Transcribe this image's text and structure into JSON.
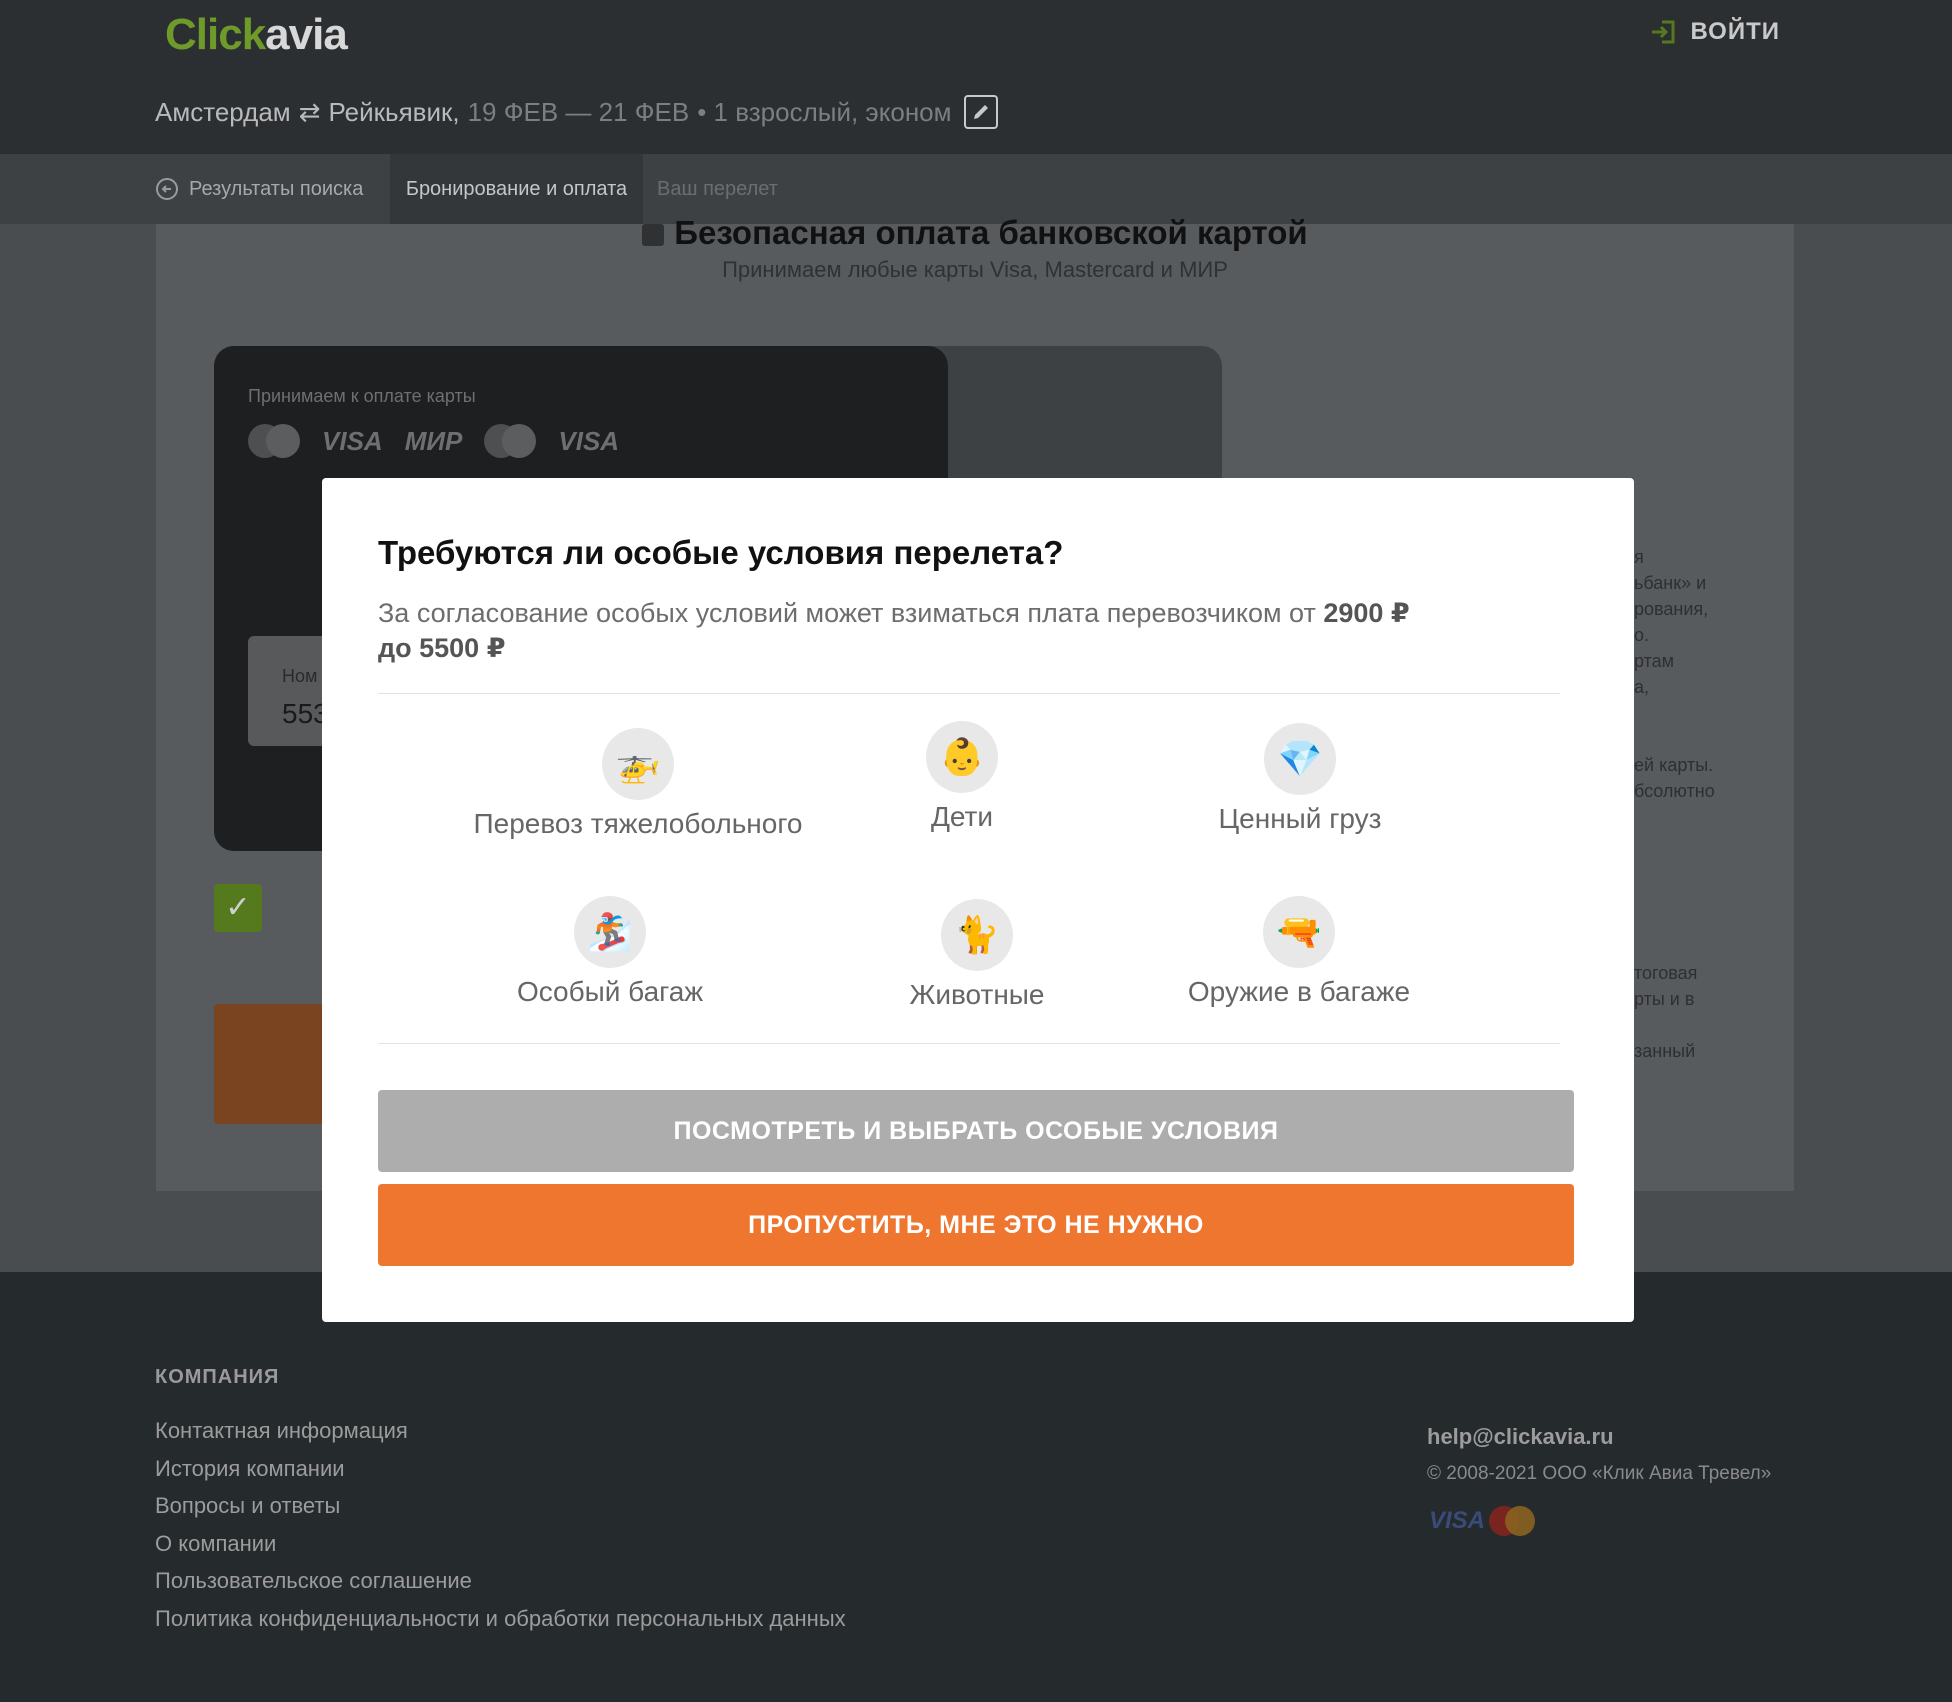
{
  "header": {
    "logo_part1": "Click",
    "logo_part2": "avia",
    "login_label": "ВОЙТИ"
  },
  "search": {
    "from": "Амстердам",
    "swap_symbol": "⇄",
    "to": "Рейкьявик,",
    "dates": "19 ФЕВ — 21 ФЕВ",
    "passengers": "• 1 взрослый, эконом"
  },
  "breadcrumbs": {
    "back": "Результаты поиска",
    "active": "Бронирование и оплата",
    "next": "Ваш перелет"
  },
  "payment": {
    "title": "Безопасная оплата банковской картой",
    "subtitle": "Принимаем любые карты Visa, Mastercard и МИР",
    "accept_label": "Принимаем к оплате карты",
    "card_logos": [
      "VISA",
      "МИР",
      "VISA"
    ],
    "card_number_label": "Ном",
    "card_number_value": "553"
  },
  "side_text": [
    "я",
    "ьбанк» и",
    "рования,",
    "о.",
    "",
    "ртам",
    "а,",
    "",
    "",
    "ей карты.",
    "бсолютно",
    "",
    "",
    "",
    "",
    "",
    "",
    "тоговая",
    "рты и в",
    "",
    "занный"
  ],
  "modal": {
    "title": "Требуются ли особые условия перелета?",
    "desc_prefix": "За согласование особых условий может взиматься плата перевозчиком от ",
    "desc_from": "2900 ₽",
    "desc_mid": " ",
    "desc_to": "до 5500 ₽",
    "options": [
      {
        "label": "Перевоз тяжелобольного",
        "emoji": "🚁",
        "icon": "helicopter-icon"
      },
      {
        "label": "Дети",
        "emoji": "👶",
        "icon": "baby-icon"
      },
      {
        "label": "Ценный груз",
        "emoji": "💎",
        "icon": "gem-icon"
      },
      {
        "label": "Особый багаж",
        "emoji": "🏂",
        "icon": "snowboarder-icon"
      },
      {
        "label": "Животные",
        "emoji": "🐈",
        "icon": "cat-icon"
      },
      {
        "label": "Оружие в багаже",
        "emoji": "🔫",
        "icon": "water-pistol-icon"
      }
    ],
    "view_button": "ПОСМОТРЕТЬ И ВЫБРАТЬ ОСОБЫЕ УСЛОВИЯ",
    "skip_button": "ПРОПУСТИТЬ, МНЕ ЭТО НЕ НУЖНО"
  },
  "footer": {
    "heading": "КОМПАНИЯ",
    "links": [
      "Контактная информация",
      "История компании",
      "Вопросы и ответы",
      "О компании",
      "Пользовательское соглашение",
      "Политика конфиденциальности и обработки персональных данных"
    ],
    "email": "help@clickavia.ru",
    "copyright": "© 2008-2021 ООО «Клик Авиа Тревел»",
    "visa": "VISA"
  },
  "colors": {
    "accent_orange": "#ef762f",
    "brand_green": "#6e9a2a",
    "button_grey": "#adadad"
  }
}
